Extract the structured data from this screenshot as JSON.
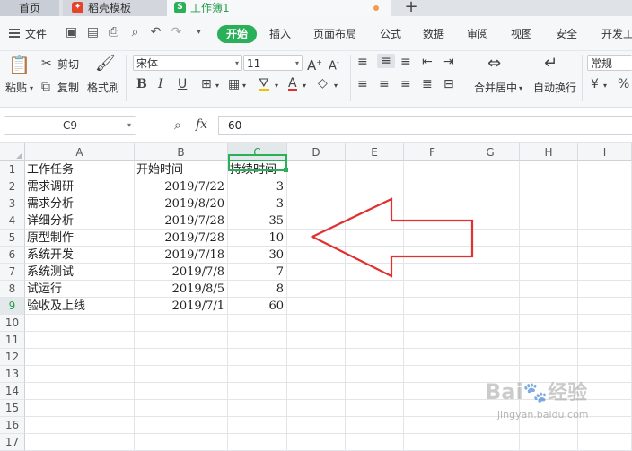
{
  "tabs": {
    "home": "首页",
    "template": "稻壳模板",
    "workbook": "工作簿1",
    "workbook_icon_letter": "S"
  },
  "menu": {
    "file": "文件",
    "items": [
      "开始",
      "插入",
      "页面布局",
      "公式",
      "数据",
      "审阅",
      "视图",
      "安全",
      "开发工"
    ],
    "active": "开始"
  },
  "ribbon": {
    "paste": "粘贴",
    "cut": "剪切",
    "copy": "复制",
    "format_painter": "格式刷",
    "font_name": "宋体",
    "font_size": "11",
    "merge_center": "合并居中",
    "wrap_text": "自动换行",
    "number_format": "常规"
  },
  "formula_bar": {
    "cell_ref": "C9",
    "fx": "fx",
    "value": "60"
  },
  "columns": [
    "A",
    "B",
    "C",
    "D",
    "E",
    "F",
    "G",
    "H",
    "I"
  ],
  "rows": [
    "1",
    "2",
    "3",
    "4",
    "5",
    "6",
    "7",
    "8",
    "9",
    "10",
    "11",
    "12",
    "13",
    "14",
    "15",
    "16",
    "17"
  ],
  "sheet": [
    [
      "工作任务",
      "开始时间",
      "持续时间"
    ],
    [
      "需求调研",
      "2019/7/22",
      "3"
    ],
    [
      "需求分析",
      "2019/8/20",
      "3"
    ],
    [
      "详细分析",
      "2019/7/28",
      "35"
    ],
    [
      "原型制作",
      "2019/7/28",
      "10"
    ],
    [
      "系统开发",
      "2019/7/18",
      "30"
    ],
    [
      "系统测试",
      "2019/7/8",
      "7"
    ],
    [
      "试运行",
      "2019/8/5",
      "8"
    ],
    [
      "验收及上线",
      "2019/7/1",
      "60"
    ]
  ],
  "selected": {
    "col": "C",
    "row": "9"
  },
  "watermark": {
    "brand": "Bai",
    "brand_cn": "经验",
    "url": "jingyan.baidu.com"
  },
  "colors": {
    "accent": "#2bb05a",
    "arrow": "#e03030"
  }
}
